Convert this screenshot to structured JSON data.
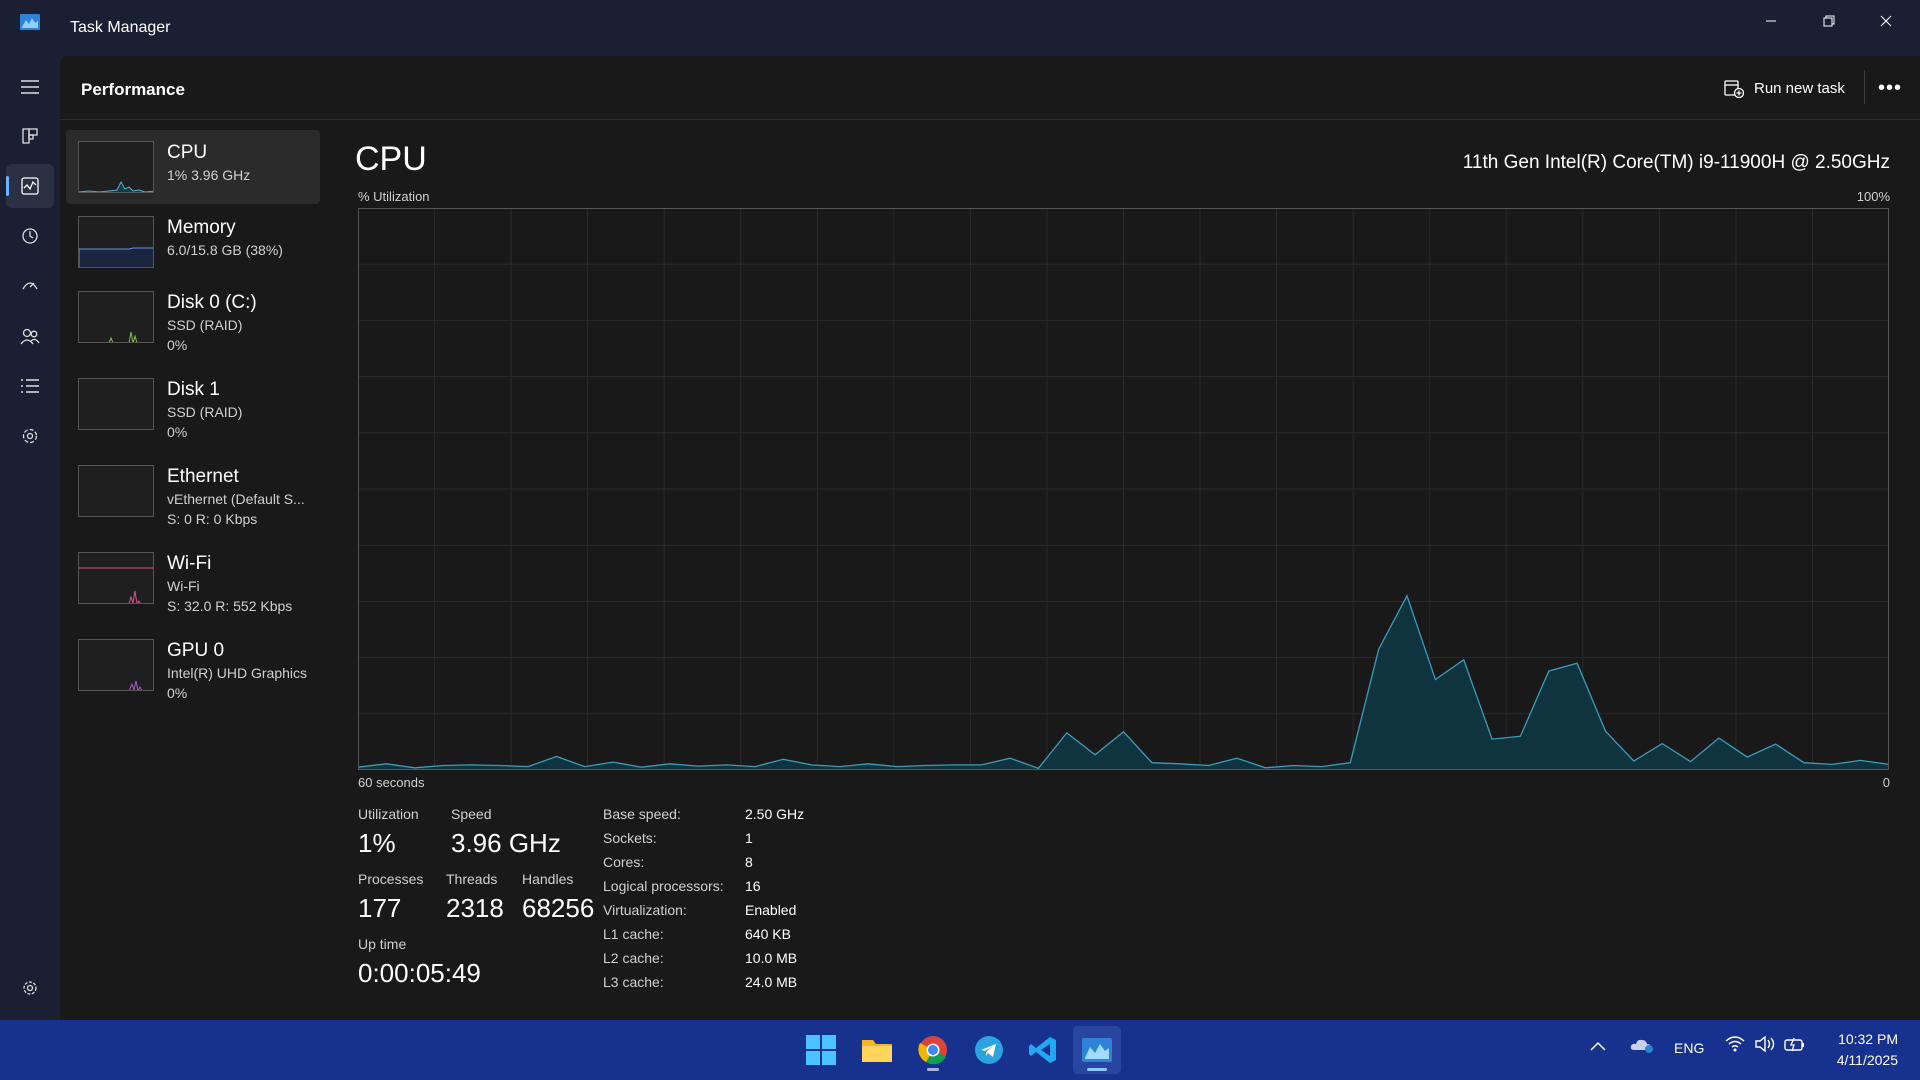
{
  "window": {
    "title": "Task Manager"
  },
  "header": {
    "title": "Performance",
    "run_task_label": "Run new task",
    "more_label": "•••"
  },
  "devices": [
    {
      "name": "CPU",
      "line1": "1% 3.96 GHz",
      "line2": "",
      "color": "#4db3cf"
    },
    {
      "name": "Memory",
      "line1": "6.0/15.8 GB (38%)",
      "line2": "",
      "color": "#6a8fe0"
    },
    {
      "name": "Disk 0 (C:)",
      "line1": "SSD (RAID)",
      "line2": "0%",
      "color": "#7fc34a"
    },
    {
      "name": "Disk 1",
      "line1": "SSD (RAID)",
      "line2": "0%",
      "color": "#7fc34a"
    },
    {
      "name": "Ethernet",
      "line1": "vEthernet (Default S...",
      "line2": "S: 0 R: 0 Kbps",
      "color": "#d1568a"
    },
    {
      "name": "Wi-Fi",
      "line1": "Wi-Fi",
      "line2": "S: 32.0 R: 552 Kbps",
      "color": "#d1568a"
    },
    {
      "name": "GPU 0",
      "line1": "Intel(R) UHD Graphics",
      "line2": "0%",
      "color": "#a957d1"
    }
  ],
  "cpu": {
    "title": "CPU",
    "model": "11th Gen Intel(R) Core(TM) i9-11900H @ 2.50GHz",
    "graph_label": "% Utilization",
    "graph_max": "100%",
    "time_label": "60 seconds",
    "time_end": "0",
    "utilization_label": "Utilization",
    "utilization": "1%",
    "speed_label": "Speed",
    "speed": "3.96 GHz",
    "processes_label": "Processes",
    "processes": "177",
    "threads_label": "Threads",
    "threads": "2318",
    "handles_label": "Handles",
    "handles": "68256",
    "uptime_label": "Up time",
    "uptime": "0:00:05:49",
    "specs": [
      {
        "key": "Base speed:",
        "value": "2.50 GHz"
      },
      {
        "key": "Sockets:",
        "value": "1"
      },
      {
        "key": "Cores:",
        "value": "8"
      },
      {
        "key": "Logical processors:",
        "value": "16"
      },
      {
        "key": "Virtualization:",
        "value": "Enabled"
      },
      {
        "key": "L1 cache:",
        "value": "640 KB"
      },
      {
        "key": "L2 cache:",
        "value": "10.0 MB"
      },
      {
        "key": "L3 cache:",
        "value": "24.0 MB"
      }
    ],
    "history": [
      0.5,
      1.1,
      0.4,
      0.8,
      0.9,
      0.8,
      0.6,
      2.4,
      0.6,
      1.4,
      0.5,
      1.1,
      0.7,
      0.9,
      0.6,
      1.9,
      0.9,
      0.6,
      1.1,
      0.6,
      0.8,
      0.9,
      0.9,
      2.1,
      0.3,
      6.6,
      2.7,
      6.8,
      1.3,
      1.1,
      0.8,
      2.1,
      0.4,
      0.8,
      0.6,
      1.3,
      21.5,
      31.0,
      16.1,
      19.6,
      5.5,
      6.0,
      17.6,
      19.0,
      6.9,
      1.6,
      4.7,
      1.5,
      5.7,
      2.3,
      4.6,
      1.3,
      1.0,
      1.7,
      1.0
    ]
  },
  "taskbar": {
    "apps": [
      "start-icon",
      "file-explorer-icon",
      "chrome-icon",
      "telegram-icon",
      "vscode-icon",
      "task-manager-icon"
    ],
    "lang": "ENG",
    "time": "10:32 PM",
    "date": "4/11/2025"
  },
  "colors": {
    "cpu_line": "#3c9bb8",
    "cpu_fill": "#0f3440",
    "grid": "#2a2a2a",
    "accent": "#6ab3ff"
  }
}
